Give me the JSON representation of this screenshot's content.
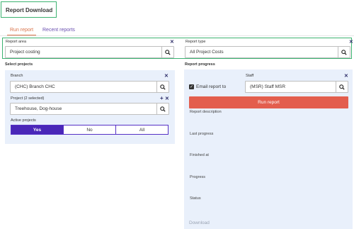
{
  "header": {
    "title": "Report Download"
  },
  "tabs": [
    {
      "label": "Run report",
      "active": true
    },
    {
      "label": "Recent reports",
      "active": false
    }
  ],
  "report_area": {
    "label": "Report area",
    "value": "Project costing"
  },
  "report_type": {
    "label": "Report type",
    "value": "All Project Costs"
  },
  "select_projects": {
    "title": "Select projects",
    "branch": {
      "label": "Branch",
      "value": "(CHC) Branch CHC"
    },
    "project": {
      "label": "Project (2 selected)",
      "value": "Treehouse, Dog-house"
    },
    "active_projects": {
      "label": "Active projects",
      "options": [
        "Yes",
        "No",
        "All"
      ],
      "selected": "Yes"
    }
  },
  "report_progress": {
    "title": "Report progress",
    "email_label": "Email report to",
    "email_checked": true,
    "staff": {
      "label": "Staff",
      "value": "(MSR) Staff MSR"
    },
    "run_label": "Run report",
    "fields": {
      "description": "Report description",
      "last_progress": "Last progress",
      "finished_at": "Finished at",
      "progress": "Progress",
      "status": "Status"
    },
    "download_label": "Download"
  },
  "colors": {
    "accent_green": "#3cb371",
    "run_button": "#e35e4d",
    "toggle_selected": "#4a27b8",
    "panel_bg": "#e9f0fb",
    "tab_active": "#d9734a",
    "tab_inactive": "#6a4fb0"
  },
  "icons": [
    "search-icon",
    "close-icon",
    "plus-icon",
    "checkbox-checked-icon"
  ]
}
